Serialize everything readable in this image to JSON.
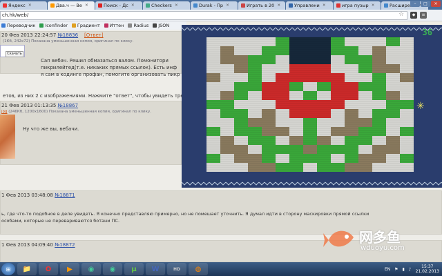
{
  "tabs": [
    {
      "label": "Яндекс",
      "fav": "#e33",
      "active": false
    },
    {
      "label": "Два.ч — Ве",
      "fav": "#f90",
      "active": true
    },
    {
      "label": "Поиск - Дс",
      "fav": "#d22",
      "active": false
    },
    {
      "label": "Checkers",
      "fav": "#4a8",
      "active": false
    },
    {
      "label": "Durak - Пр",
      "fav": "#48c",
      "active": false
    },
    {
      "label": "Играть в 20",
      "fav": "#c44",
      "active": false
    },
    {
      "label": "Управлени",
      "fav": "#36a",
      "active": false
    },
    {
      "label": "игра пузыр",
      "fav": "#d33",
      "active": false
    },
    {
      "label": "Расширени",
      "fav": "#48c",
      "active": false
    }
  ],
  "address": {
    "url": "ch.hk/web/"
  },
  "bookmarks": [
    {
      "label": "Переводчик",
      "icon": "translate-icon",
      "color": "#3a7bd5"
    },
    {
      "label": "Iconfinder",
      "icon": "iconfinder-icon",
      "color": "#2d9d4c"
    },
    {
      "label": "Градиент",
      "icon": "gradient-icon",
      "color": "#e0a020"
    },
    {
      "label": "Иттен",
      "icon": "itten-icon",
      "color": "#c03060"
    },
    {
      "label": "Radius",
      "icon": "radius-icon",
      "color": "#888"
    },
    {
      "label": "JSON",
      "icon": "json-icon",
      "color": "#444"
    }
  ],
  "posts": {
    "p1": {
      "date": "20 Фев 2013 22:24:57",
      "num": "№18836",
      "reply": "[Ответ]",
      "file": "(1Кб, 242x72)",
      "file_note": "Показана уменьшенная копия, оригинал по клику.",
      "btn": "Скачать",
      "lines": [
        "Сап вебач. Решил обмазаться валом. Помонитори",
        "пикрилейтед(т.е. никаких прямых ссылок). Есть инф",
        "я сам в кодинге профан, помогите организовать пикр"
      ]
    },
    "omitted": "етов, из них 2 с изображениями. Нажмите \"ответ\", чтобы увидеть тре",
    "p2": {
      "date": "21 Фев 2013 01:13:35",
      "num": "№18867",
      "file_link": "jpg",
      "file": "(246Кб, 1200x1600)",
      "file_note": "Показана уменьшенная копия, оригинал по клику.",
      "text": "Ну что же вы, вебачи."
    },
    "p3": {
      "date": "1 Фев 2013 03:48:08",
      "num": "№18871",
      "lines": [
        "ь, где что-то подобное в деле увидеть. Я конечно представляю примерно, но не помешает уточнить. Я думал идти в сторону маскировки прямой ссылки",
        "особами, которые не перевариваются ботани ПС."
      ]
    },
    "p4": {
      "date": "1 Фев 2013 04:09:40",
      "num": "№18872"
    }
  },
  "game": {
    "score": "36",
    "cursor_color": "#e8e060"
  },
  "watermark": {
    "title": "网多鱼",
    "sub": "wduoyu.com"
  },
  "taskbar": {
    "apps": [
      "folder-icon",
      "opera-icon",
      "media-icon",
      "chrome-icon",
      "chrome-icon",
      "utorrent-icon",
      "word-icon",
      "hd-icon",
      "firefox-icon"
    ],
    "lang": "EN",
    "time": "15:37",
    "date": "21.02.2013"
  }
}
